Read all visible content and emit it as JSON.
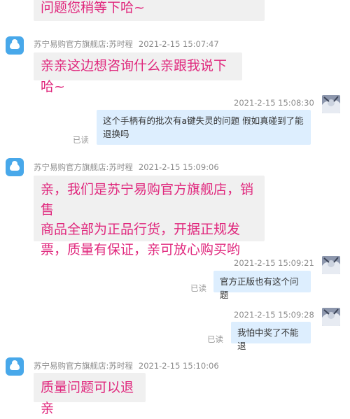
{
  "chat": {
    "messages": [
      {
        "direction": "in",
        "sender": "",
        "time": "",
        "text": "问题您稍等下哈~"
      },
      {
        "direction": "in",
        "sender": "苏宁易购官方旗舰店:苏时程",
        "time": "2021-2-15 15:07:47",
        "text": "亲亲这边想咨询什么亲跟我说下哈~"
      },
      {
        "direction": "out",
        "time": "2021-2-15 15:08:30",
        "text_line1": "这个手柄有的批次有a键失灵的问题 假如真碰到了能",
        "text_line2": "退换吗",
        "status": "已读"
      },
      {
        "direction": "in",
        "sender": "苏宁易购官方旗舰店:苏时程",
        "time": "2021-2-15 15:09:06",
        "text_line1": "亲，我们是苏宁易购官方旗舰店，销售",
        "text_line2": "商品全部为正品行货，开据正规发",
        "text_line3": "票，质量有保证，亲可放心购买哟"
      },
      {
        "direction": "out",
        "time": "2021-2-15 15:09:21",
        "text": "官方正版也有这个问题",
        "status": "已读"
      },
      {
        "direction": "out",
        "time": "2021-2-15 15:09:28",
        "text": "我怕中奖了不能退",
        "status": "已读"
      },
      {
        "direction": "in",
        "sender": "苏宁易购官方旗舰店:苏时程",
        "time": "2021-2-15 15:10:06",
        "text": "质量问题可以退亲"
      }
    ]
  },
  "icons": {
    "agent_avatar": "cloud-avatar-icon",
    "user_avatar": "user-photo-icon"
  },
  "colors": {
    "agent_text": "#e0287d",
    "agent_bubble": "#f0f0f0",
    "user_bubble": "#ddeefe",
    "agent_avatar": "#48a8ea"
  }
}
